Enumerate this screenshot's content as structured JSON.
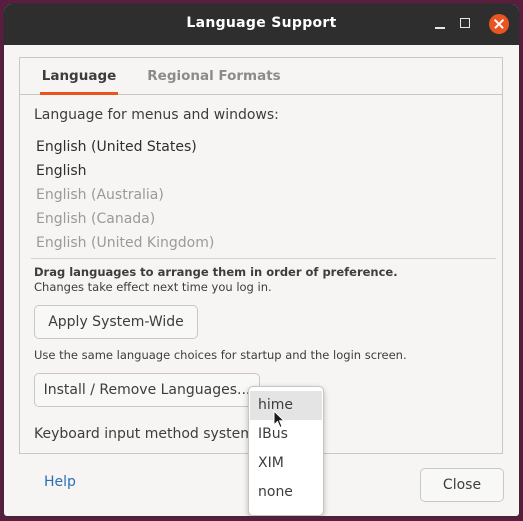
{
  "window": {
    "title": "Language Support"
  },
  "tabs": [
    {
      "label": "Language",
      "active": true
    },
    {
      "label": "Regional Formats",
      "active": false
    }
  ],
  "language": {
    "heading": "Language for menus and windows:",
    "items": [
      "English (United States)",
      "English",
      "English (Australia)",
      "English (Canada)",
      "English (United Kingdom)"
    ],
    "drag_hint": "Drag languages to arrange them in order of preference.",
    "changes_note": "Changes take effect next time you log in.",
    "apply_button": "Apply System-Wide",
    "apply_note": "Use the same language choices for startup and the login screen.",
    "install_button": "Install / Remove Languages...",
    "input_method_label": "Keyboard input method system:",
    "input_method_options": [
      "hime",
      "IBus",
      "XIM",
      "none"
    ],
    "highlighted_option": "hime"
  },
  "footer": {
    "help": "Help",
    "close": "Close"
  },
  "colors": {
    "accent": "#e95420",
    "titlebar": "#2e2e2e",
    "link": "#2a6db5"
  }
}
